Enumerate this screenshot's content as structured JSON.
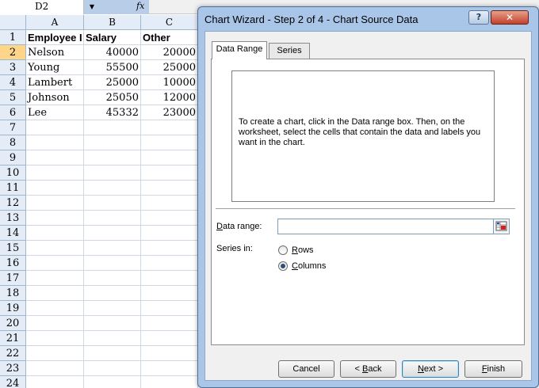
{
  "formula_bar": {
    "name_box": "D2",
    "dropdown_icon": "▼",
    "fx_label": "fx"
  },
  "sheet": {
    "columns": [
      "A",
      "B",
      "C"
    ],
    "rows": [
      {
        "num": "1",
        "a": "Employee I",
        "b": "Salary",
        "c": "Other"
      },
      {
        "num": "2",
        "a": "Nelson",
        "b": "40000",
        "c": "20000"
      },
      {
        "num": "3",
        "a": "Young",
        "b": "55500",
        "c": "25000"
      },
      {
        "num": "4",
        "a": "Lambert",
        "b": "25000",
        "c": "10000"
      },
      {
        "num": "5",
        "a": "Johnson",
        "b": "25050",
        "c": "12000"
      },
      {
        "num": "6",
        "a": "Lee",
        "b": "45332",
        "c": "23000"
      },
      {
        "num": "7",
        "a": "",
        "b": "",
        "c": ""
      },
      {
        "num": "8",
        "a": "",
        "b": "",
        "c": ""
      },
      {
        "num": "9",
        "a": "",
        "b": "",
        "c": ""
      },
      {
        "num": "10",
        "a": "",
        "b": "",
        "c": ""
      },
      {
        "num": "11",
        "a": "",
        "b": "",
        "c": ""
      },
      {
        "num": "12",
        "a": "",
        "b": "",
        "c": ""
      },
      {
        "num": "13",
        "a": "",
        "b": "",
        "c": ""
      },
      {
        "num": "14",
        "a": "",
        "b": "",
        "c": ""
      },
      {
        "num": "15",
        "a": "",
        "b": "",
        "c": ""
      },
      {
        "num": "16",
        "a": "",
        "b": "",
        "c": ""
      },
      {
        "num": "17",
        "a": "",
        "b": "",
        "c": ""
      },
      {
        "num": "18",
        "a": "",
        "b": "",
        "c": ""
      },
      {
        "num": "19",
        "a": "",
        "b": "",
        "c": ""
      },
      {
        "num": "20",
        "a": "",
        "b": "",
        "c": ""
      },
      {
        "num": "21",
        "a": "",
        "b": "",
        "c": ""
      },
      {
        "num": "22",
        "a": "",
        "b": "",
        "c": ""
      },
      {
        "num": "23",
        "a": "",
        "b": "",
        "c": ""
      },
      {
        "num": "24",
        "a": "",
        "b": "",
        "c": ""
      }
    ],
    "selected_row": "2"
  },
  "dialog": {
    "title": "Chart Wizard - Step 2 of 4 - Chart Source Data",
    "help_icon": "?",
    "close_icon": "✕",
    "tabs": [
      {
        "label": "Data Range",
        "active": true
      },
      {
        "label": "Series",
        "active": false
      }
    ],
    "preview_text": "To create a chart, click in the Data range box. Then, on the worksheet, select the cells that contain the data and labels you want in the chart.",
    "data_range": {
      "label_pre": "",
      "label_u": "D",
      "label_post": "ata range:",
      "value": ""
    },
    "series_in": {
      "label": "Series in:",
      "options": [
        {
          "u": "R",
          "rest": "ows",
          "selected": false
        },
        {
          "u": "C",
          "rest": "olumns",
          "selected": true
        }
      ]
    },
    "buttons": {
      "cancel": "Cancel",
      "back_pre": "< ",
      "back_u": "B",
      "back_post": "ack",
      "next_u": "N",
      "next_post": "ext >",
      "finish_u": "F",
      "finish_post": "inish"
    },
    "colors": {
      "title_bg": "#a9c6e8",
      "close_red": "#c2412c",
      "selection_orange": "#ffd58a"
    }
  }
}
